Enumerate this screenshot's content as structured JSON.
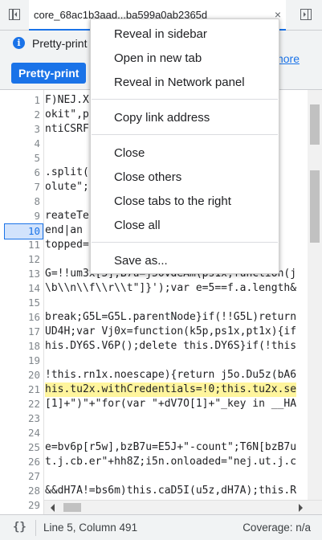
{
  "tabbar": {
    "tab_title": "core_68ac1b3aad...ba599a0ab2365d",
    "close_glyph": "×",
    "accent": "#1a73e8"
  },
  "infobar": {
    "info_glyph": "i",
    "message": "Pretty-print",
    "button_label": "Pretty-print",
    "link_text": "more"
  },
  "code": {
    "lines": [
      {
        "n": "1",
        "text": "F)NEJ.X                         DG5L"
      },
      {
        "n": "2",
        "text": "okit\",p                      e it"
      },
      {
        "n": "3",
        "text": "ntiCSRF                      ooki"
      },
      {
        "n": "4",
        "text": ""
      },
      {
        "n": "5",
        "text": ""
      },
      {
        "n": "6",
        "text": ".split(                     ption"
      },
      {
        "n": "7",
        "text": "olute\";                     LP0x"
      },
      {
        "n": "8",
        "text": ""
      },
      {
        "n": "9",
        "text": "reateTe                     lo7h."
      },
      {
        "n": "10",
        "text": "end|an                     on)$"
      },
      {
        "n": "11",
        "text": "topped=                     A5F("
      },
      {
        "n": "12",
        "text": ""
      },
      {
        "n": "13",
        "text": "G=!!um3x[5],B7u=j5OVdeAm(ps1x,function(j"
      },
      {
        "n": "14",
        "text": "\\b\\\\n\\\\f\\\\r\\\\t\"]}');var e=5==f.a.length&"
      },
      {
        "n": "15",
        "text": ""
      },
      {
        "n": "16",
        "text": "break;G5L=G5L.parentNode}if(!!G5L)return"
      },
      {
        "n": "17",
        "text": "UD4H;var Vj0x=function(k5p,ps1x,pt1x){if"
      },
      {
        "n": "18",
        "text": "his.DY6S.V6P();delete this.DY6S}if(!this"
      },
      {
        "n": "19",
        "text": ""
      },
      {
        "n": "20",
        "text": "!this.rn1x.noescape){return j5o.Du5z(bA6"
      },
      {
        "n": "21",
        "text": "his.tu2x.withCredentials=!0;this.tu2x.se"
      },
      {
        "n": "22",
        "text": "[1]+\")\"+\"for(var \"+dV7O[1]+\"_key in __HA"
      },
      {
        "n": "23",
        "text": ""
      },
      {
        "n": "24",
        "text": ""
      },
      {
        "n": "25",
        "text": "e=bv6p[r5w],bzB7u=E5J+\"-count\";T6N[bzB7u"
      },
      {
        "n": "26",
        "text": "t.j.cb.er\"+hh8Z;i5n.onloaded=\"nej.ut.j.c"
      },
      {
        "n": "27",
        "text": ""
      },
      {
        "n": "28",
        "text": "&&dH7A!=bs6m)this.caD5I(u5z,dH7A);this.R"
      },
      {
        "n": "29",
        "text": ""
      }
    ],
    "active_line": "10",
    "highlight_line": "21"
  },
  "status": {
    "braces": "{}",
    "position": "Line 5, Column 491",
    "coverage": "Coverage: n/a"
  },
  "menu": {
    "items": [
      "Reveal in sidebar",
      "Open in new tab",
      "Reveal in Network panel",
      "Copy link address",
      "Close",
      "Close others",
      "Close tabs to the right",
      "Close all",
      "Save as..."
    ]
  }
}
